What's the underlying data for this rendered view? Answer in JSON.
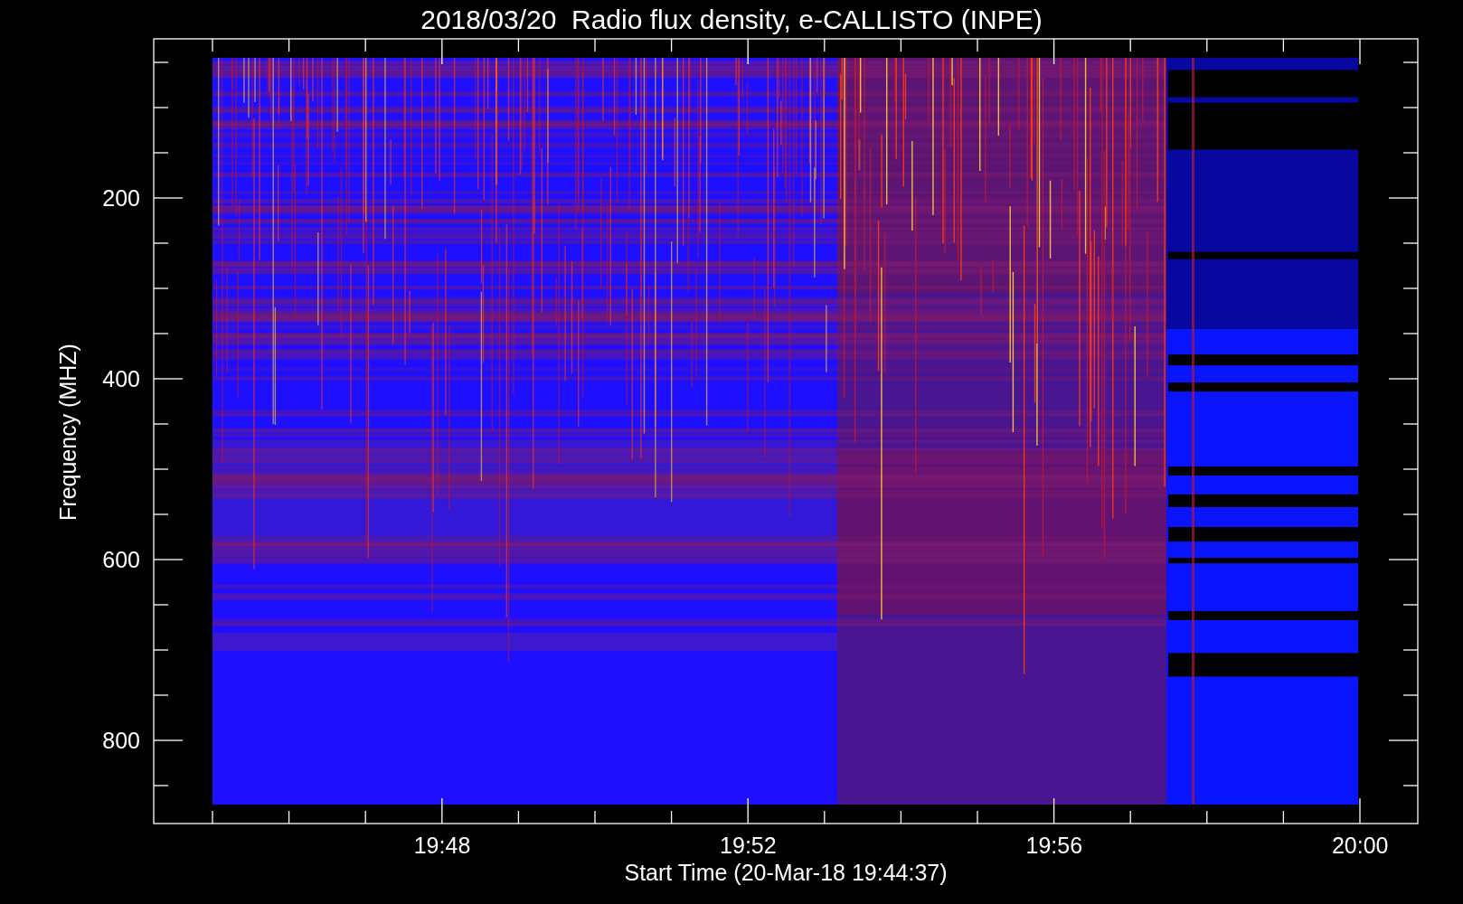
{
  "title": "2018/03/20  Radio flux density, e-CALLISTO (INPE)",
  "y_axis": {
    "label": "Frequency (MHZ)",
    "ticks": [
      "200",
      "400",
      "600",
      "800"
    ]
  },
  "x_axis": {
    "label": "Start Time (20-Mar-18 19:44:37)",
    "ticks": [
      "19:48",
      "19:52",
      "19:56",
      "20:00"
    ]
  }
}
